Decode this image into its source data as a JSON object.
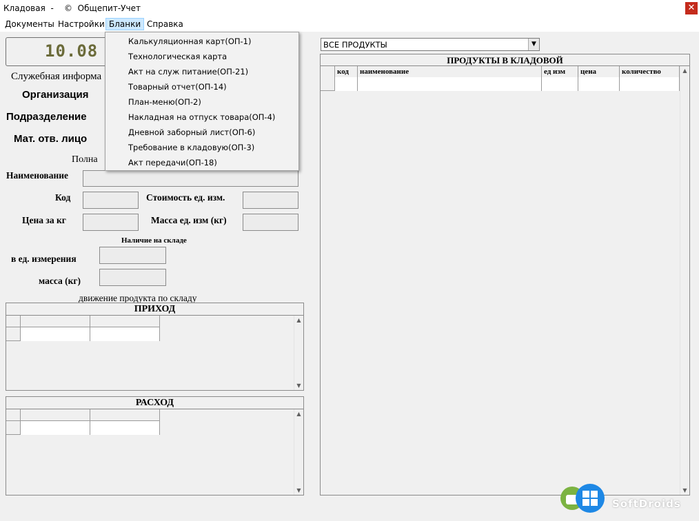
{
  "window": {
    "title": "Кладовая  -    ©  Общепит-Учет",
    "close_glyph": "✕"
  },
  "menu": {
    "items": [
      "Документы",
      "Настройки",
      "Бланки",
      "Справка"
    ],
    "active": "Бланки",
    "dropdown": [
      "Калькуляционная карт(ОП-1)",
      "Технологическая карта",
      "Акт на служ питание(ОП-21)",
      "Товарный отчет(ОП-14)",
      "План-меню(ОП-2)",
      "Накладная на отпуск товара(ОП-4)",
      "Дневной заборный лист(ОП-6)",
      "Требование в кладовую(ОП-3)",
      "Акт передачи(ОП-18)"
    ]
  },
  "date_display": "10.08",
  "info": {
    "service_info": "Служебная информа",
    "organization": "Организация",
    "division": "Подразделение",
    "responsible": "Мат. отв. лицо",
    "full": "Полна"
  },
  "product": {
    "name_label": "Наименование",
    "code_label": "Код",
    "cost_label": "Стоимость ед. изм.",
    "price_label": "Цена за кг",
    "mass_label": "Масса ед. изм (кг)",
    "stock_title": "Наличие на складе",
    "unit_label": "в ед. измерения",
    "mass_kg_label": "масса (кг)"
  },
  "movement": {
    "title": "движение продукта по складу",
    "income": "ПРИХОД",
    "expense": "РАСХОД"
  },
  "storeroom": {
    "filter_value": "ВСЕ ПРОДУКТЫ",
    "title": "ПРОДУКТЫ В КЛАДОВОЙ",
    "columns": [
      "код",
      "наименование",
      "ед изм",
      "цена",
      "количество"
    ]
  },
  "watermark": "SoftDroids",
  "colors": {
    "accent_menu": "#cce8ff",
    "close": "#c42b1c",
    "digits": "#6b6b3a",
    "watermark_green": "#7cb342",
    "watermark_blue": "#1e88e5"
  }
}
